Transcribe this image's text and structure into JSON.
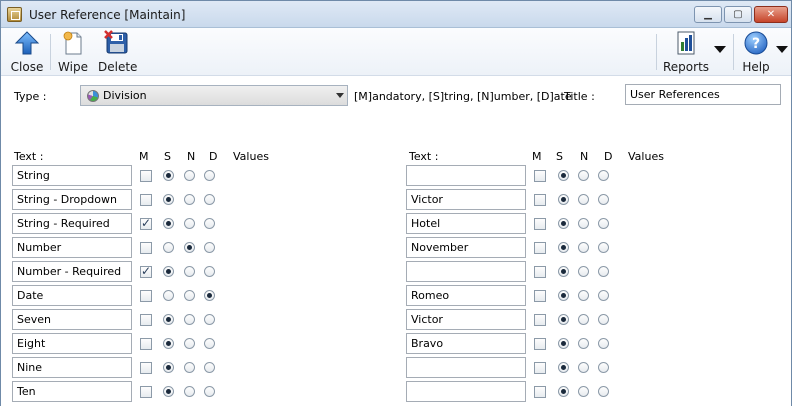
{
  "window": {
    "title": "User Reference [Maintain]",
    "controls": {
      "minimize": "▁",
      "maximize": "▢",
      "close": "✕"
    }
  },
  "toolbar": {
    "close_label": "Close",
    "wipe_label": "Wipe",
    "delete_label": "Delete",
    "reports_label": "Reports",
    "help_label": "Help"
  },
  "form": {
    "type_label": "Type :",
    "type_value": "Division",
    "legend": "[M]andatory, [S]tring, [N]umber, [D]ate",
    "title_label": "Title :",
    "title_value": "User References"
  },
  "columns": {
    "text": "Text :",
    "m": "M",
    "s": "S",
    "n": "N",
    "d": "D",
    "values": "Values"
  },
  "left_rows": [
    {
      "text": "String",
      "mandatory": false,
      "type": "S"
    },
    {
      "text": "String - Dropdown",
      "mandatory": false,
      "type": "S"
    },
    {
      "text": "String - Required",
      "mandatory": true,
      "type": "S"
    },
    {
      "text": "Number",
      "mandatory": false,
      "type": "N"
    },
    {
      "text": "Number - Required",
      "mandatory": true,
      "type": "S"
    },
    {
      "text": "Date",
      "mandatory": false,
      "type": "D"
    },
    {
      "text": "Seven",
      "mandatory": false,
      "type": "S"
    },
    {
      "text": "Eight",
      "mandatory": false,
      "type": "S"
    },
    {
      "text": "Nine",
      "mandatory": false,
      "type": "S"
    },
    {
      "text": "Ten",
      "mandatory": false,
      "type": "S"
    }
  ],
  "right_rows": [
    {
      "text": "",
      "mandatory": false,
      "type": "S"
    },
    {
      "text": "Victor",
      "mandatory": false,
      "type": "S"
    },
    {
      "text": "Hotel",
      "mandatory": false,
      "type": "S"
    },
    {
      "text": "November",
      "mandatory": false,
      "type": "S"
    },
    {
      "text": "",
      "mandatory": false,
      "type": "S"
    },
    {
      "text": "Romeo",
      "mandatory": false,
      "type": "S"
    },
    {
      "text": "Victor",
      "mandatory": false,
      "type": "S"
    },
    {
      "text": "Bravo",
      "mandatory": false,
      "type": "S"
    },
    {
      "text": "",
      "mandatory": false,
      "type": "S"
    },
    {
      "text": "",
      "mandatory": false,
      "type": "S"
    }
  ],
  "icons": {
    "app": "app-icon",
    "close": "up-arrow-icon",
    "wipe": "new-page-icon",
    "delete": "floppy-disk-icon",
    "reports": "report-icon",
    "help": "help-icon"
  },
  "colors": {
    "accent": "#2f6fbf",
    "titlebar": "#c9d9ec",
    "close_button": "#c6452a"
  }
}
